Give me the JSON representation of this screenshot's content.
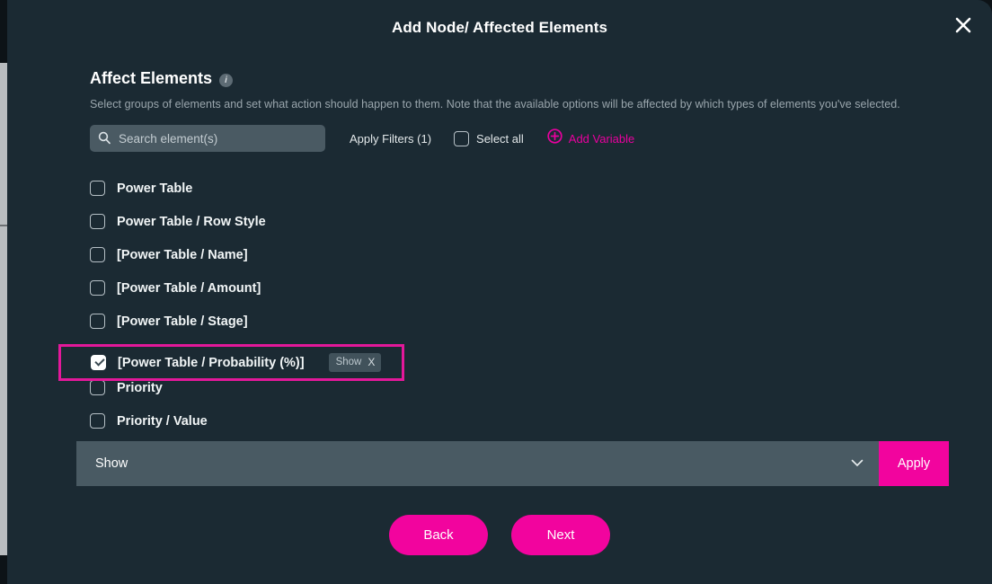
{
  "modal": {
    "title": "Add Node/ Affected Elements",
    "close_icon": "close-icon"
  },
  "section": {
    "title": "Affect Elements",
    "info_icon": "i",
    "description": "Select groups of elements and set what action should happen to them. Note that the available options will be affected by which types of elements you've selected."
  },
  "toolbar": {
    "search": {
      "icon": "search-icon",
      "placeholder": "Search element(s)",
      "value": ""
    },
    "apply_filters_label": "Apply Filters (1)",
    "select_all_label": "Select all",
    "select_all_checked": false,
    "add_variable_label": "Add Variable",
    "add_variable_icon": "plus-circle-icon"
  },
  "elements": [
    {
      "label": "Power Table",
      "checked": false,
      "action": null
    },
    {
      "label": "Power Table / Row Style",
      "checked": false,
      "action": null
    },
    {
      "label": "[Power Table / Name]",
      "checked": false,
      "action": null
    },
    {
      "label": "[Power Table / Amount]",
      "checked": false,
      "action": null
    },
    {
      "label": "[Power Table / Stage]",
      "checked": false,
      "action": null
    },
    {
      "label": "[Power Table / Probability (%)]",
      "checked": true,
      "action": "Show",
      "action_remove": "X",
      "highlighted": true
    },
    {
      "label": "Priority",
      "checked": false,
      "action": null
    },
    {
      "label": "Priority / Value",
      "checked": false,
      "action": null
    }
  ],
  "apply_bar": {
    "selected_action": "Show",
    "chevron_icon": "chevron-down-icon",
    "apply_label": "Apply"
  },
  "footer": {
    "back_label": "Back",
    "next_label": "Next"
  },
  "colors": {
    "modal_background": "#1b2a33",
    "accent_magenta": "#f2049e",
    "highlight_border": "#e3189a",
    "control_slate": "#495a63",
    "chip_background": "#41525b",
    "muted_text": "#9aa6ad"
  }
}
